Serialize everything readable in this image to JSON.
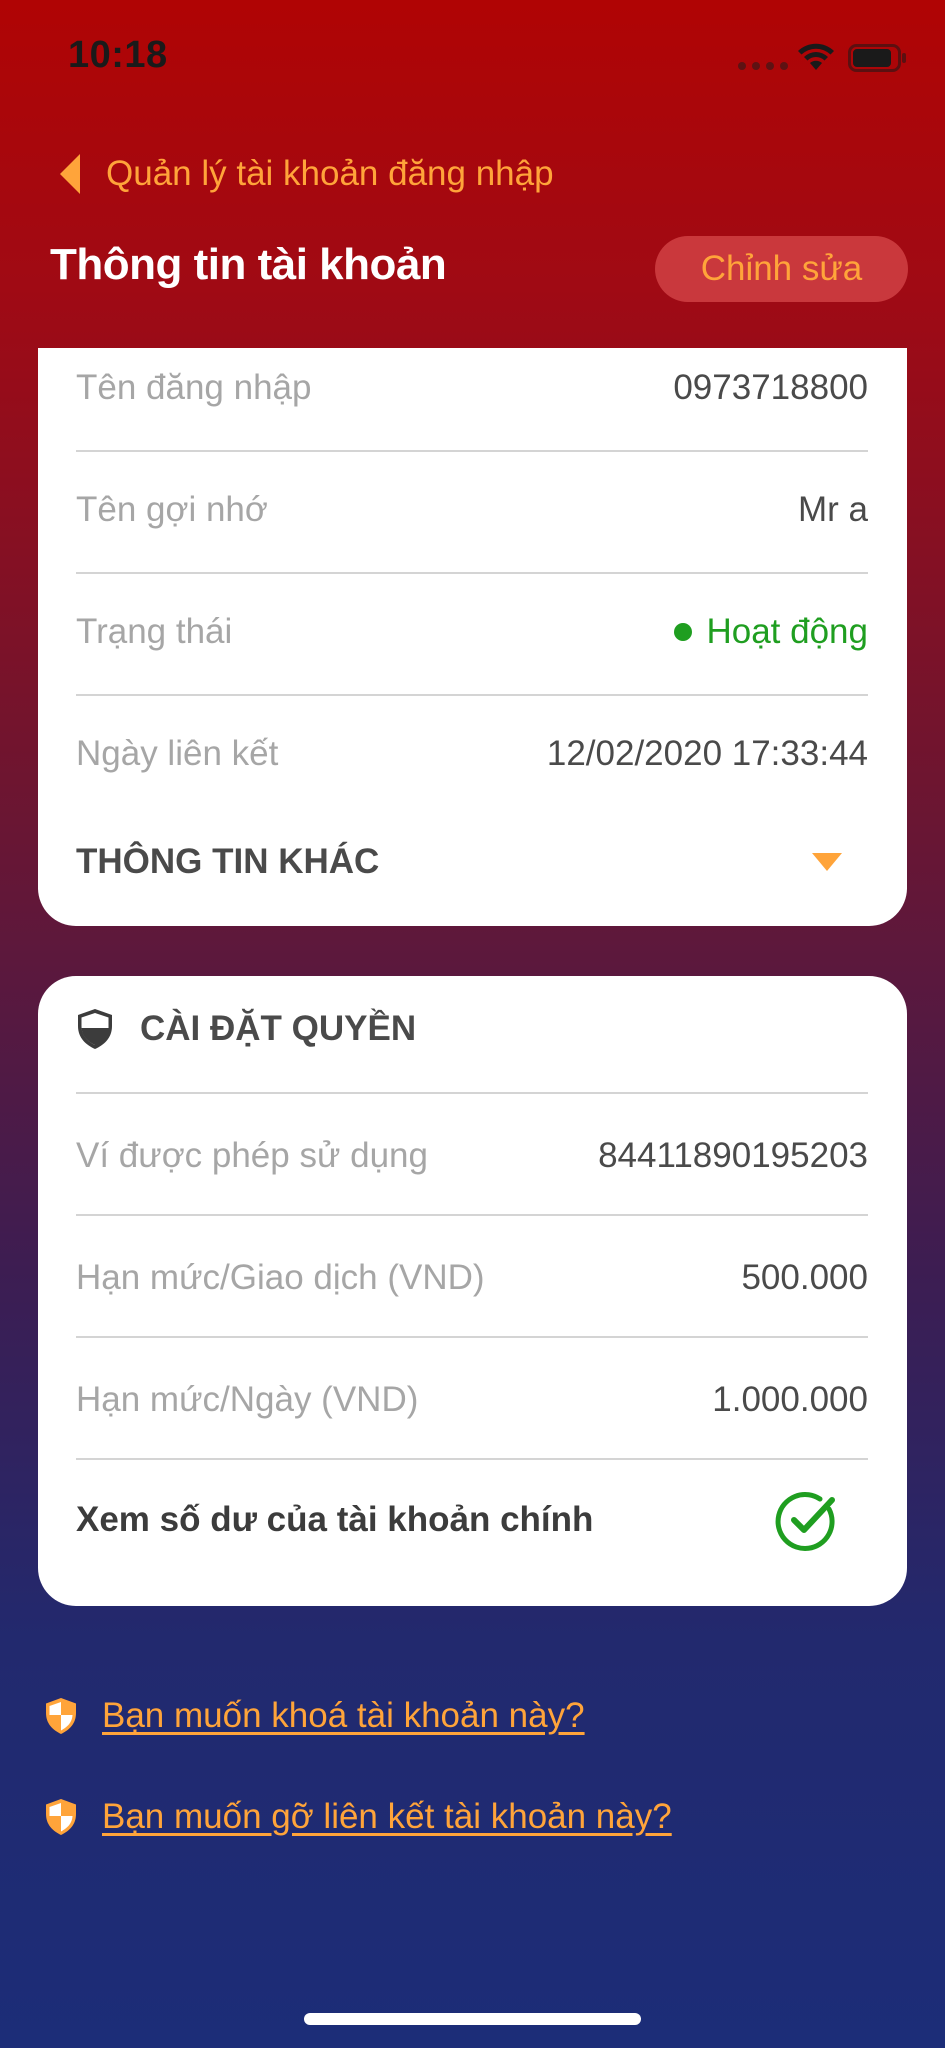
{
  "status_bar": {
    "time": "10:18"
  },
  "nav": {
    "back_label": "Quản lý tài khoản đăng nhập"
  },
  "header": {
    "title": "Thông tin tài khoản",
    "edit_label": "Chỉnh sửa"
  },
  "account_info": {
    "rows": [
      {
        "label": "Tên đăng nhập",
        "value": "0973718800"
      },
      {
        "label": "Tên gợi nhớ",
        "value": "Mr a"
      },
      {
        "label": "Trạng thái",
        "value": "Hoạt động",
        "status_color": "#1f9e20"
      },
      {
        "label": "Ngày liên kết",
        "value": "12/02/2020 17:33:44"
      }
    ],
    "other_info_label": "THÔNG TIN KHÁC"
  },
  "permissions": {
    "title": "CÀI ĐẶT QUYỀN",
    "rows": [
      {
        "label": "Ví được phép sử dụng",
        "value": "84411890195203"
      },
      {
        "label": "Hạn mức/Giao dịch (VND)",
        "value": "500.000"
      },
      {
        "label": "Hạn mức/Ngày (VND)",
        "value": "1.000.000"
      }
    ],
    "view_balance_label": "Xem số dư của tài khoản chính",
    "view_balance_enabled": true
  },
  "links": {
    "lock_account": "Bạn muốn khoá tài khoản này?",
    "unlink_account": "Bạn muốn gỡ liên kết tài khoản này?"
  },
  "colors": {
    "accent": "#ffa43a",
    "active": "#1f9e20",
    "header_red": "#b00404",
    "footer_blue": "#1c2d78"
  },
  "icons": {
    "back": "chevron-left-icon",
    "expand": "caret-down-icon",
    "permissions": "shield-icon",
    "check": "check-circle-icon",
    "warning": "shield-half-icon"
  }
}
